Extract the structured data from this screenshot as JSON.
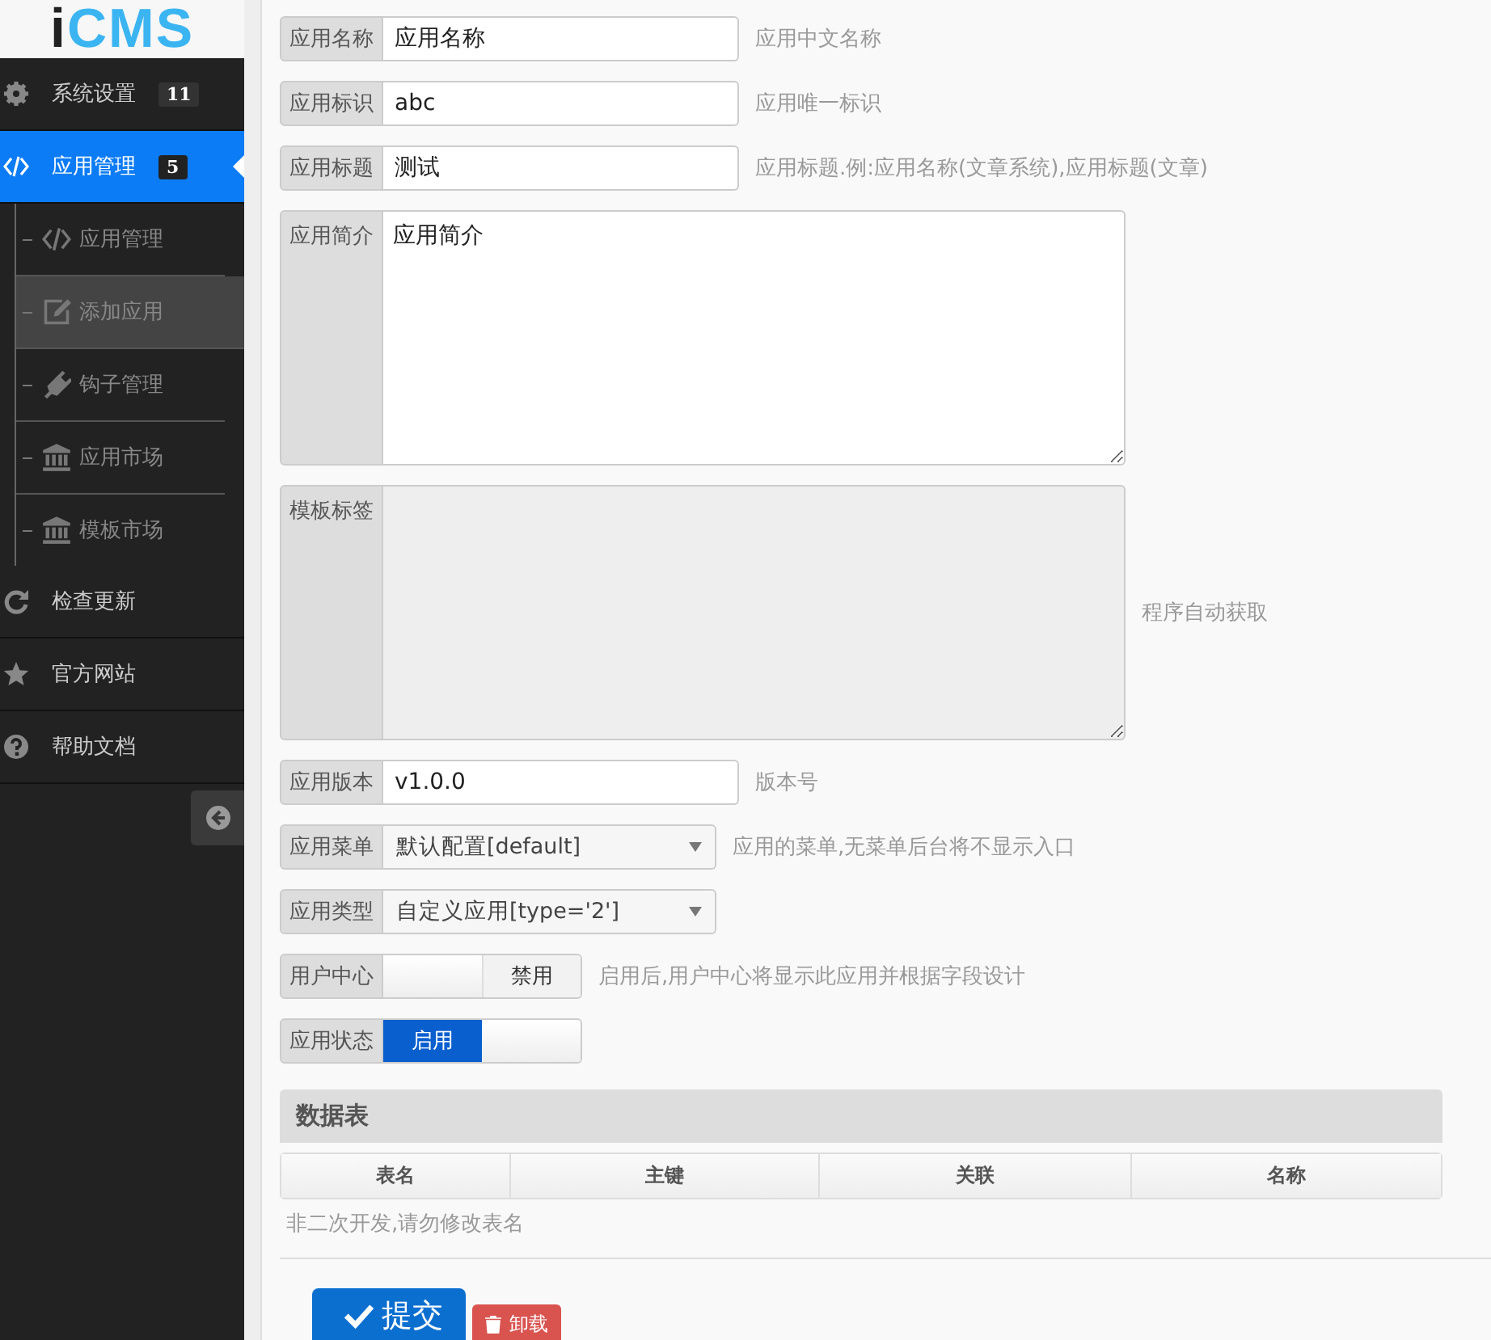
{
  "logo": {
    "text": "iCMS"
  },
  "sidebar": {
    "items": [
      {
        "label": "系统设置",
        "badge": "11",
        "selected": false
      },
      {
        "label": "应用管理",
        "badge": "5",
        "selected": true,
        "expanded": true,
        "children": [
          {
            "label": "应用管理",
            "selected": false
          },
          {
            "label": "添加应用",
            "selected": true
          },
          {
            "label": "钩子管理",
            "selected": false
          },
          {
            "label": "应用市场",
            "selected": false
          },
          {
            "label": "模板市场",
            "selected": false
          }
        ]
      },
      {
        "label": "检查更新",
        "selected": false
      },
      {
        "label": "官方网站",
        "selected": false
      },
      {
        "label": "帮助文档",
        "selected": false
      }
    ]
  },
  "form": {
    "fields": [
      {
        "kind": "text",
        "label": "应用名称",
        "value": "应用名称",
        "hint": "应用中文名称"
      },
      {
        "kind": "text",
        "label": "应用标识",
        "value": "abc",
        "hint": "应用唯一标识"
      },
      {
        "kind": "text",
        "label": "应用标题",
        "value": "测试",
        "hint": "应用标题.例:应用名称(文章系统),应用标题(文章)"
      },
      {
        "kind": "textarea",
        "label": "应用简介",
        "value": "应用简介",
        "disabled": false
      },
      {
        "kind": "textarea",
        "label": "模板标签",
        "disabled": true,
        "hint": "程序自动获取"
      },
      {
        "kind": "text",
        "label": "应用版本",
        "value": "v1.0.0",
        "hint": "版本号"
      },
      {
        "kind": "select",
        "label": "应用菜单",
        "value": "默认配置[default]",
        "hint": "应用的菜单,无菜单后台将不显示入口"
      },
      {
        "kind": "select",
        "label": "应用类型",
        "value": "自定义应用[type='2']"
      },
      {
        "kind": "toggle",
        "label": "用户中心",
        "on": false,
        "state_label": "禁用",
        "hint": "启用后,用户中心将显示此应用并根据字段设计"
      },
      {
        "kind": "toggle",
        "label": "应用状态",
        "on": true,
        "state_label": "启用"
      }
    ]
  },
  "table": {
    "title": "数据表",
    "columns": [
      "表名",
      "主键",
      "关联",
      "名称"
    ],
    "note": "非二次开发,请勿修改表名"
  },
  "buttons": [
    {
      "kind": "submit",
      "label": "提交"
    },
    {
      "kind": "danger",
      "label": "卸载"
    }
  ]
}
